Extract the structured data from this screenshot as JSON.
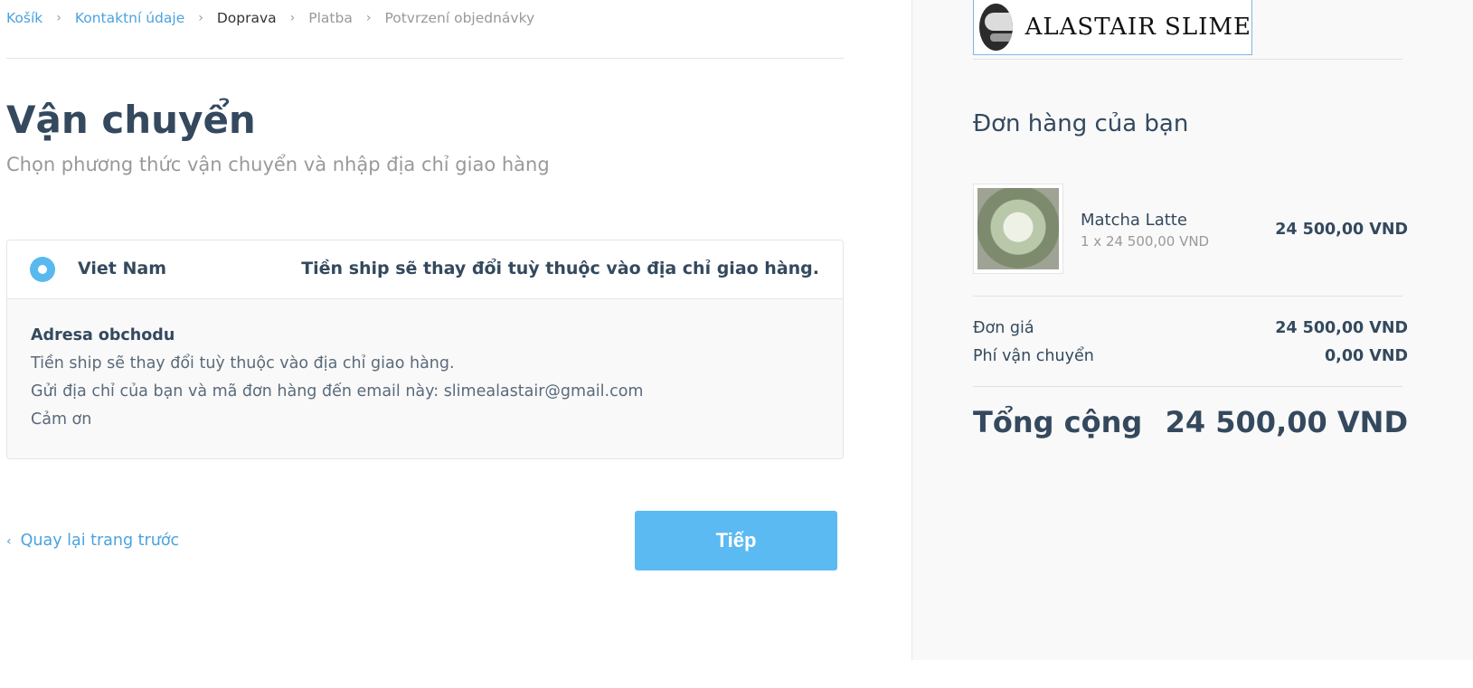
{
  "breadcrumb": {
    "items": [
      {
        "label": "Košík",
        "state": "link"
      },
      {
        "label": "Kontaktní údaje",
        "state": "link"
      },
      {
        "label": "Doprava",
        "state": "current"
      },
      {
        "label": "Platba",
        "state": "inactive"
      },
      {
        "label": "Potvrzení objednávky",
        "state": "inactive"
      }
    ],
    "separator": "›"
  },
  "shipping": {
    "title": "Vận chuyển",
    "subtitle": "Chọn phương thức vận chuyển và nhập địa chỉ giao hàng",
    "option": {
      "country": "Viet Nam",
      "note": "Tiền ship sẽ thay đổi tuỳ thuộc vào địa chỉ giao hàng.",
      "selected": true
    },
    "details": {
      "heading": "Adresa obchodu",
      "lines": [
        "Tiền ship sẽ thay đổi tuỳ thuộc vào địa chỉ giao hàng.",
        "Gửi địa chỉ của bạn và mã đơn hàng đến email này: slimealastair@gmail.com",
        "Cảm ơn"
      ]
    }
  },
  "nav": {
    "back_label": "Quay lại trang trước",
    "back_icon": "chevron-left-icon",
    "next_label": "Tiếp"
  },
  "store": {
    "logo_text": "ALASTAIR SLIME",
    "logo_icon": "store-logo-mark"
  },
  "order": {
    "title": "Đơn hàng của bạn",
    "item": {
      "name": "Matcha Latte",
      "qty_price": "1 x 24 500,00 VND",
      "price": "24 500,00 VND"
    },
    "unit_price_label": "Đơn giá",
    "unit_price_value": "24 500,00 VND",
    "shipping_label": "Phí vận chuyển",
    "shipping_value": "0,00 VND",
    "total_label": "Tổng cộng",
    "total_value": "24 500,00 VND"
  },
  "colors": {
    "accent": "#59b9ef",
    "link": "#4aa3df",
    "text": "#34495e",
    "muted": "#999999",
    "panel": "#f9f9f9"
  }
}
